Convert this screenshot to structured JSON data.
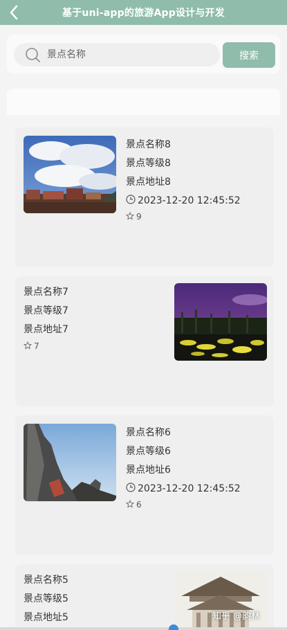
{
  "header": {
    "title": "基于uni-app的旅游App设计与开发",
    "back_icon": "chevron-left-icon"
  },
  "search": {
    "placeholder": "景点名称",
    "button_label": "搜索",
    "icon": "search-icon"
  },
  "cards": [
    {
      "name": "景点名称8",
      "level": "景点等级8",
      "address": "景点地址8",
      "time": "2023-12-20 12:45:52",
      "likes": "9",
      "image_side": "left"
    },
    {
      "name": "景点名称7",
      "level": "景点等级7",
      "address": "景点地址7",
      "likes": "7",
      "image_side": "right"
    },
    {
      "name": "景点名称6",
      "level": "景点等级6",
      "address": "景点地址6",
      "time": "2023-12-20 12:45:52",
      "likes": "6",
      "image_side": "left"
    },
    {
      "name": "景点名称5",
      "level": "景点等级5",
      "address": "景点地址5",
      "image_side": "right"
    }
  ],
  "watermark": "知乎 @韵林",
  "colors": {
    "accent": "#8fbcab",
    "card_bg": "#efefef",
    "page_bg": "#f4f4f4"
  }
}
